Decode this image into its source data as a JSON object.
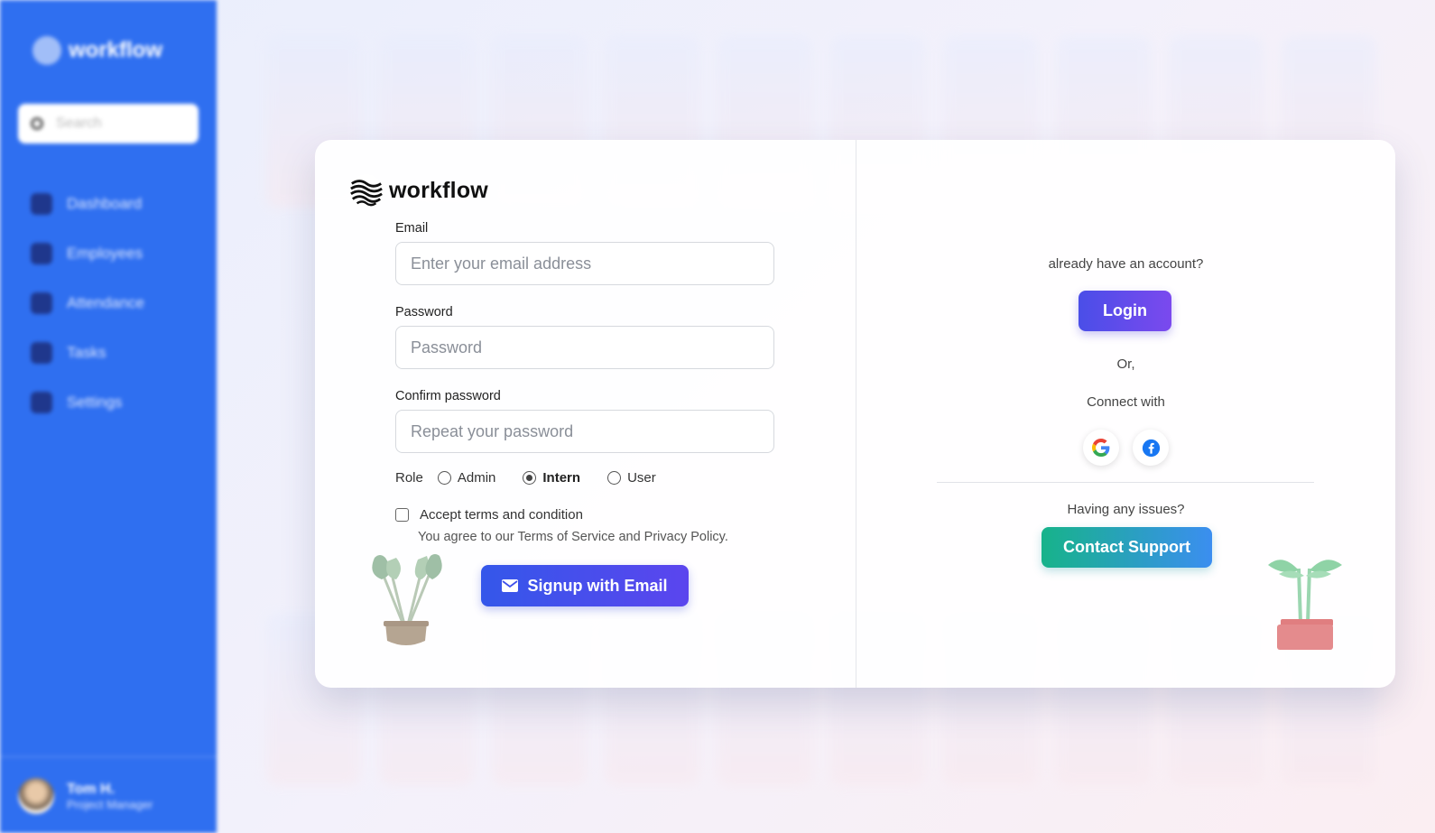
{
  "background_app": {
    "brand": "workflow",
    "search_placeholder": "Search",
    "nav": [
      {
        "label": "Dashboard",
        "icon": "home-icon"
      },
      {
        "label": "Employees",
        "icon": "users-icon"
      },
      {
        "label": "Attendance",
        "icon": "calendar-icon"
      },
      {
        "label": "Tasks",
        "icon": "checkbox-icon"
      },
      {
        "label": "Settings",
        "icon": "gear-icon"
      }
    ],
    "user": {
      "name": "Tom H.",
      "role": "Project Manager"
    }
  },
  "signup": {
    "brand": "workflow",
    "email": {
      "label": "Email",
      "placeholder": "Enter your email address",
      "value": ""
    },
    "password": {
      "label": "Password",
      "placeholder": "Password",
      "value": ""
    },
    "confirm": {
      "label": "Confirm password",
      "placeholder": "Repeat your password",
      "value": ""
    },
    "role": {
      "label": "Role",
      "options": [
        "Admin",
        "Intern",
        "User"
      ],
      "selected": "Intern"
    },
    "terms": {
      "label": "Accept terms and condition",
      "checked": false,
      "note": "You agree to our Terms of Service and Privacy Policy."
    },
    "submit_label": "Signup with Email"
  },
  "side_panel": {
    "prompt": "already have an account?",
    "login_label": "Login",
    "or_text": "Or,",
    "connect_text": "Connect with",
    "social": [
      "google-icon",
      "facebook-icon"
    ],
    "issues_text": "Having any issues?",
    "support_label": "Contact Support"
  },
  "colors": {
    "sidebar": "#2f6ff0",
    "signup_button": "#3457ea",
    "login_button": "#5b4cec",
    "support_button_start": "#17b38a",
    "support_button_end": "#3b8ef0"
  }
}
